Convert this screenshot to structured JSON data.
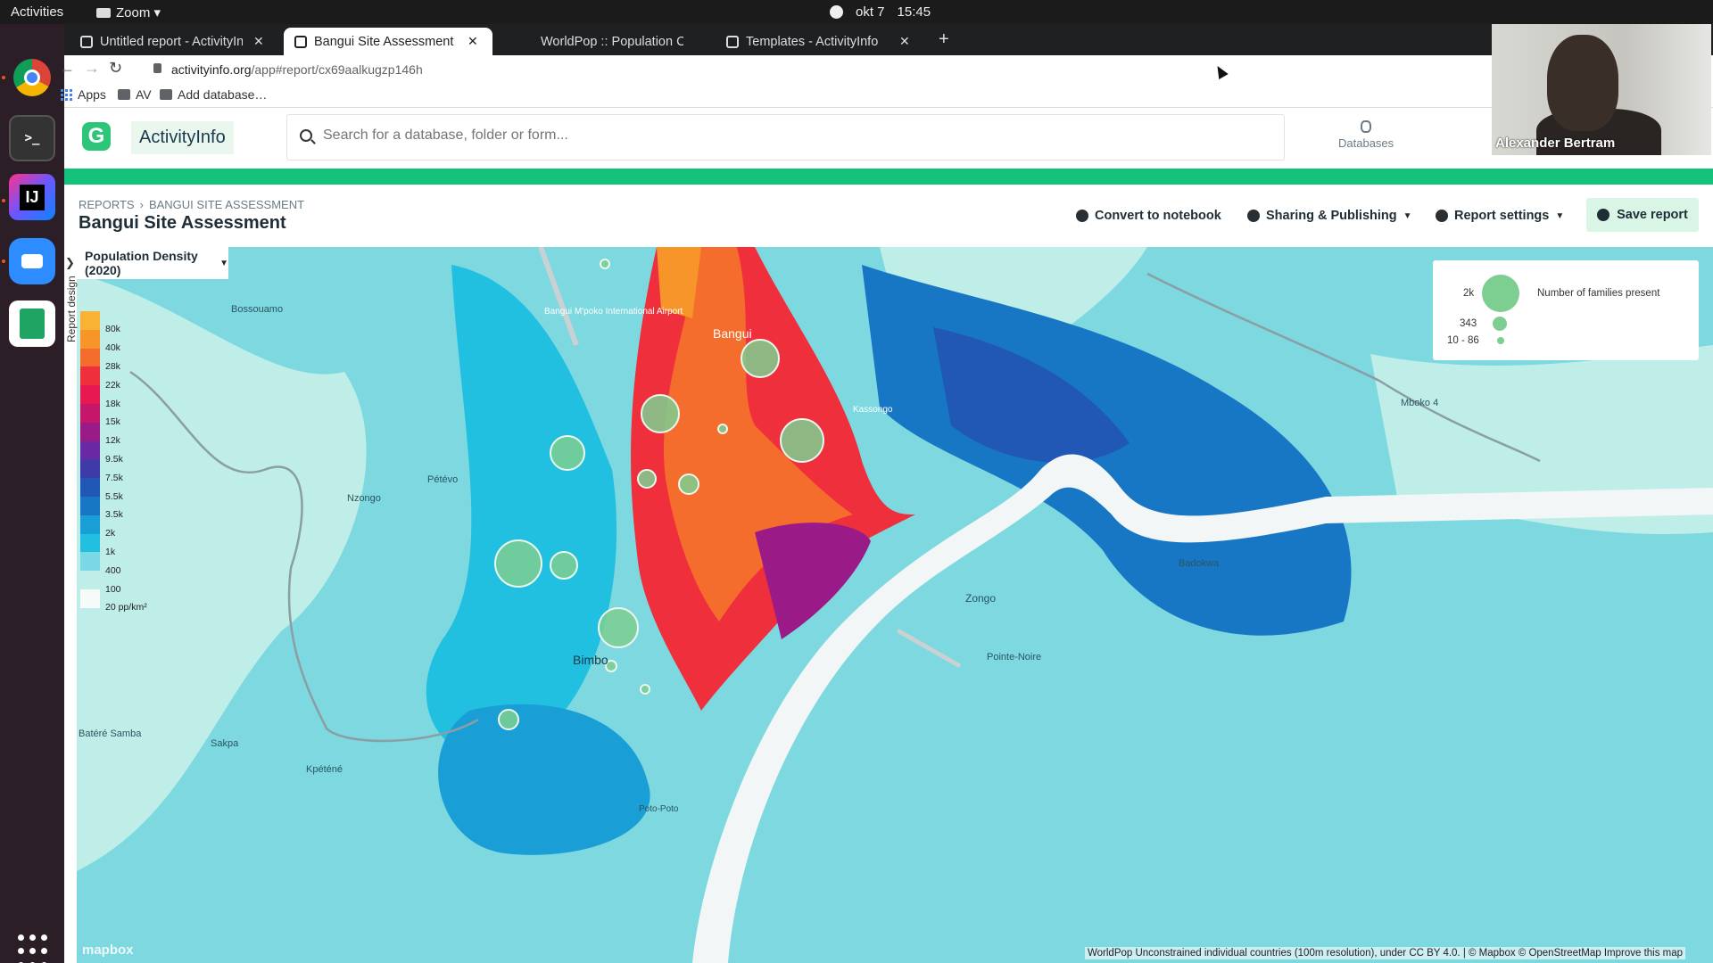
{
  "system": {
    "activities": "Activities",
    "app_menu": "Zoom ▾",
    "date": "okt 7",
    "time": "15:45"
  },
  "browser": {
    "tabs": [
      {
        "title": "Untitled report - ActivityInfo",
        "active": false
      },
      {
        "title": "Bangui Site Assessment - ActivityInfo",
        "active": true
      },
      {
        "title": "WorldPop :: Population Counts",
        "active": false
      },
      {
        "title": "Templates - ActivityInfo",
        "active": false
      }
    ],
    "url_host": "activityinfo.org",
    "url_path": "/app#report/cx69aalkugzp146h",
    "bookmarks": [
      "Apps",
      "AV",
      "Add database…"
    ]
  },
  "app": {
    "brand": "ActivityInfo",
    "search_placeholder": "Search for a database, folder or form...",
    "nav_databases": "Databases",
    "breadcrumb": [
      "REPORTS",
      "BANGUI SITE ASSESSMENT"
    ],
    "title": "Bangui Site Assessment",
    "actions": {
      "convert": "Convert to notebook",
      "sharing": "Sharing & Publishing",
      "settings": "Report settings",
      "save": "Save report"
    }
  },
  "map": {
    "side_label": "Report design",
    "layer": "Population Density (2020)",
    "density_legend": [
      {
        "label": "80k",
        "color": "#f9b233"
      },
      {
        "label": "40k",
        "color": "#f7952a"
      },
      {
        "label": "28k",
        "color": "#f56d2c"
      },
      {
        "label": "22k",
        "color": "#ef2f3c"
      },
      {
        "label": "18k",
        "color": "#e81852"
      },
      {
        "label": "15k",
        "color": "#c5166a"
      },
      {
        "label": "12k",
        "color": "#9a1a87"
      },
      {
        "label": "9.5k",
        "color": "#6a28a4"
      },
      {
        "label": "7.5k",
        "color": "#3e3aa8"
      },
      {
        "label": "5.5k",
        "color": "#2157b5"
      },
      {
        "label": "3.5k",
        "color": "#1877c4"
      },
      {
        "label": "2k",
        "color": "#1a9ed6"
      },
      {
        "label": "1k",
        "color": "#22c0e0"
      },
      {
        "label": "400",
        "color": "#79d8e3"
      },
      {
        "label": "100",
        "color": "#bfeee8"
      },
      {
        "label": "20 pp/km²",
        "color": "#f6fbf9"
      }
    ],
    "size_legend": {
      "title": "Number of families present",
      "levels": [
        "2k",
        "343",
        "10 - 86"
      ]
    },
    "place_labels": [
      "Bossouamo",
      "Bangui M'poko International Airport",
      "Bangui",
      "Mboko 4",
      "Pétévo",
      "Zongo",
      "Badokwa",
      "Bimbo",
      "Batéré Samba",
      "Sakpa",
      "Kpéténé",
      "Pointe-Noire",
      "Nzongo",
      "Kassongo",
      "Poto-Poto"
    ],
    "attribution": "WorldPop Unconstrained individual countries (100m resolution), under CC BY 4.0. | © Mapbox © OpenStreetMap Improve this map",
    "mapbox": "mapbox"
  },
  "zoom_call": {
    "participant": "Alexander Bertram"
  },
  "colors": {
    "accent": "#14c27b",
    "save_bg": "#d9f5e6",
    "site_marker": "#7dcf91"
  }
}
